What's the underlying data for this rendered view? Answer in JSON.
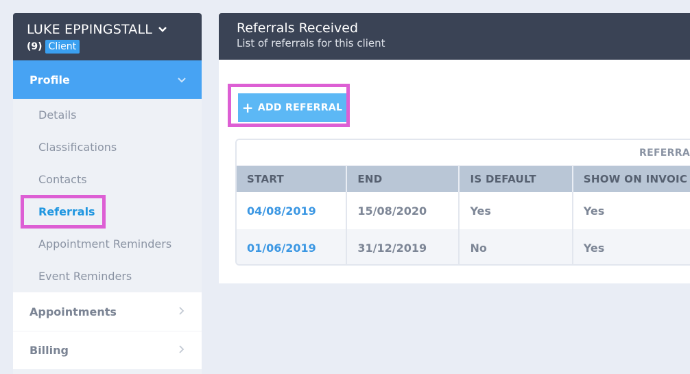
{
  "client": {
    "name": "LUKE EPPINGSTALL",
    "count": "(9)",
    "badge": "Client"
  },
  "sidebar": {
    "active_section": "Profile",
    "sub_items": [
      {
        "label": "Details"
      },
      {
        "label": "Classifications"
      },
      {
        "label": "Contacts"
      },
      {
        "label": "Referrals"
      },
      {
        "label": "Appointment Reminders"
      },
      {
        "label": "Event Reminders"
      }
    ],
    "sections": [
      {
        "label": "Appointments"
      },
      {
        "label": "Billing"
      }
    ]
  },
  "panel": {
    "title": "Referrals Received",
    "subtitle": "List of referrals for this client",
    "add_button": "ADD REFERRAL",
    "group_header": "REFERRAL",
    "columns": [
      "START",
      "END",
      "IS DEFAULT",
      "SHOW ON INVOIC"
    ],
    "rows": [
      {
        "start": "04/08/2019",
        "end": "15/08/2020",
        "is_default": "Yes",
        "show_on_invoice": "Yes"
      },
      {
        "start": "01/06/2019",
        "end": "31/12/2019",
        "is_default": "No",
        "show_on_invoice": "Yes"
      }
    ]
  },
  "colors": {
    "header_bg": "#3a4355",
    "active_blue": "#47a3f3",
    "link_blue": "#3b97e3",
    "highlight_pink": "#dd5fd4"
  }
}
